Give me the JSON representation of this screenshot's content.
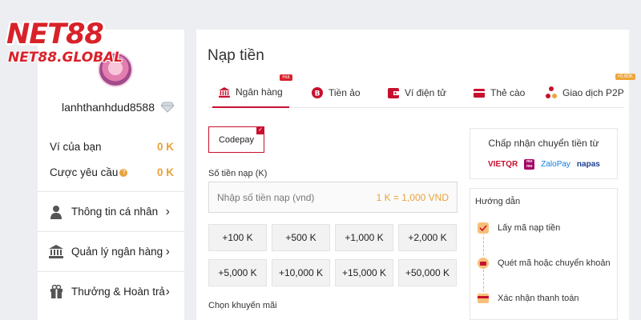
{
  "logo": {
    "main": "NET88",
    "sub": "NET88.GLOBAL"
  },
  "user": {
    "username": "lanhthanhdud8588"
  },
  "balances": [
    {
      "label": "Ví của bạn",
      "value": "0 K"
    },
    {
      "label": "Cược yêu cầu",
      "value": "0 K",
      "info": "?"
    }
  ],
  "menu": [
    {
      "label": "Thông tin cá nhân",
      "icon": "user-icon"
    },
    {
      "label": "Quản lý ngân hàng",
      "icon": "bank-icon"
    },
    {
      "label": "Thưởng & Hoàn trả",
      "icon": "gift-icon"
    }
  ],
  "chevron": "›",
  "page": {
    "title": "Nạp tiền"
  },
  "tabs": [
    {
      "label": "Ngân hàng",
      "icon": "bank-icon",
      "badge": "Hot",
      "active": true
    },
    {
      "label": "Tiền ảo",
      "icon": "bitcoin-icon"
    },
    {
      "label": "Ví điện tử",
      "icon": "wallet-icon"
    },
    {
      "label": "Thẻ cào",
      "icon": "card-icon"
    },
    {
      "label": "Giao dịch P2P",
      "icon": "p2p-icon",
      "badge": "+0.60K"
    }
  ],
  "method": {
    "label": "Codepay",
    "check": "✓"
  },
  "amount": {
    "label": "Số tiền nạp (K)",
    "placeholder": "Nhập số tiền nạp (vnd)",
    "rate": "1 K = 1,000 VND"
  },
  "quick_amounts": [
    "+100 K",
    "+500 K",
    "+1,000 K",
    "+2,000 K",
    "+5,000 K",
    "+10,000 K",
    "+15,000 K",
    "+50,000 K"
  ],
  "promo": {
    "label": "Chọn khuyến mãi"
  },
  "accept": {
    "title": "Chấp nhận chuyển tiền từ",
    "logos": [
      "VIETQR",
      "mo mo",
      "ZaloPay",
      "napas"
    ]
  },
  "guide": {
    "title": "Hướng dẫn",
    "steps": [
      "Lấy mã nạp tiền",
      "Quét mã hoặc chuyển khoản",
      "Xác nhận thanh toán"
    ]
  },
  "colors": {
    "brand": "#d8222a",
    "accent": "#e8a23a",
    "active_border": "#c8102e"
  }
}
